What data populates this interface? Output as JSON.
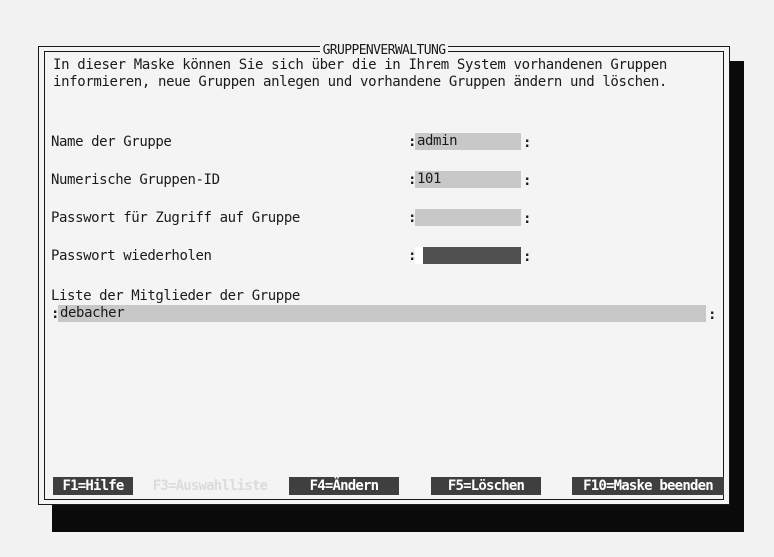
{
  "window": {
    "title": "GRUPPENVERWALTUNG",
    "intro_line1": "In dieser Maske können Sie sich über die in Ihrem System vorhandenen Gruppen",
    "intro_line2": "informieren, neue Gruppen anlegen und vorhandene Gruppen ändern und löschen."
  },
  "form": {
    "group_name_label": "Name der Gruppe",
    "group_name_value": "admin",
    "group_id_label": "Numerische Gruppen-ID",
    "group_id_value": "101",
    "password_label": "Passwort für Zugriff auf Gruppe",
    "password_value": "",
    "password_repeat_label": "Passwort wiederholen",
    "password_repeat_value": "",
    "members_label": "Liste der Mitglieder der Gruppe",
    "members_value": "debacher",
    "separator": ":"
  },
  "function_keys": {
    "help": "F1=Hilfe",
    "select_list": "F3=Auswahlliste",
    "change": "F4=Ändern",
    "delete": "F5=Löschen",
    "quit": "F10=Maske beenden"
  },
  "colors": {
    "field_bg": "#c8c8c8",
    "active_field_bg": "#505050",
    "fn_bar_bg": "#3f3f3f",
    "fn_disabled_text": "#dcdcdc"
  }
}
